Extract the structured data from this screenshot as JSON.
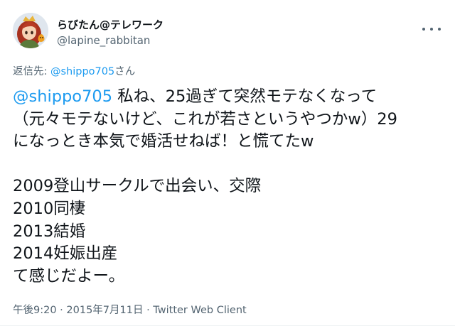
{
  "user": {
    "display_name": "らびたん@テレワーク",
    "handle": "@lapine_rabbitan",
    "avatar_icon": "avatar-image"
  },
  "menu": {
    "icon": "more-horizontal-icon"
  },
  "reply": {
    "prefix": "返信先: ",
    "mention": "@shippo705",
    "suffix": "さん"
  },
  "tweet": {
    "mention": "@shippo705",
    "line1_rest": " 私ね、25過ぎて突然モテなくなって",
    "lines_a": [
      "（元々モテないけど、これが若さというやつかw）29",
      "になっとき本気で婚活せねば！と慌てたw"
    ],
    "lines_b": [
      "2009登山サークルで出会い、交際",
      "2010同棲",
      "2013結婚",
      "2014妊娠出産",
      "て感じだよー。"
    ]
  },
  "meta": {
    "time": "午後9:20",
    "sep1": " · ",
    "date": "2015年7月11日",
    "sep2": " · ",
    "client": "Twitter Web Client"
  },
  "colors": {
    "link": "#1d9bf0",
    "text": "#0f1419",
    "secondary": "#536471"
  }
}
